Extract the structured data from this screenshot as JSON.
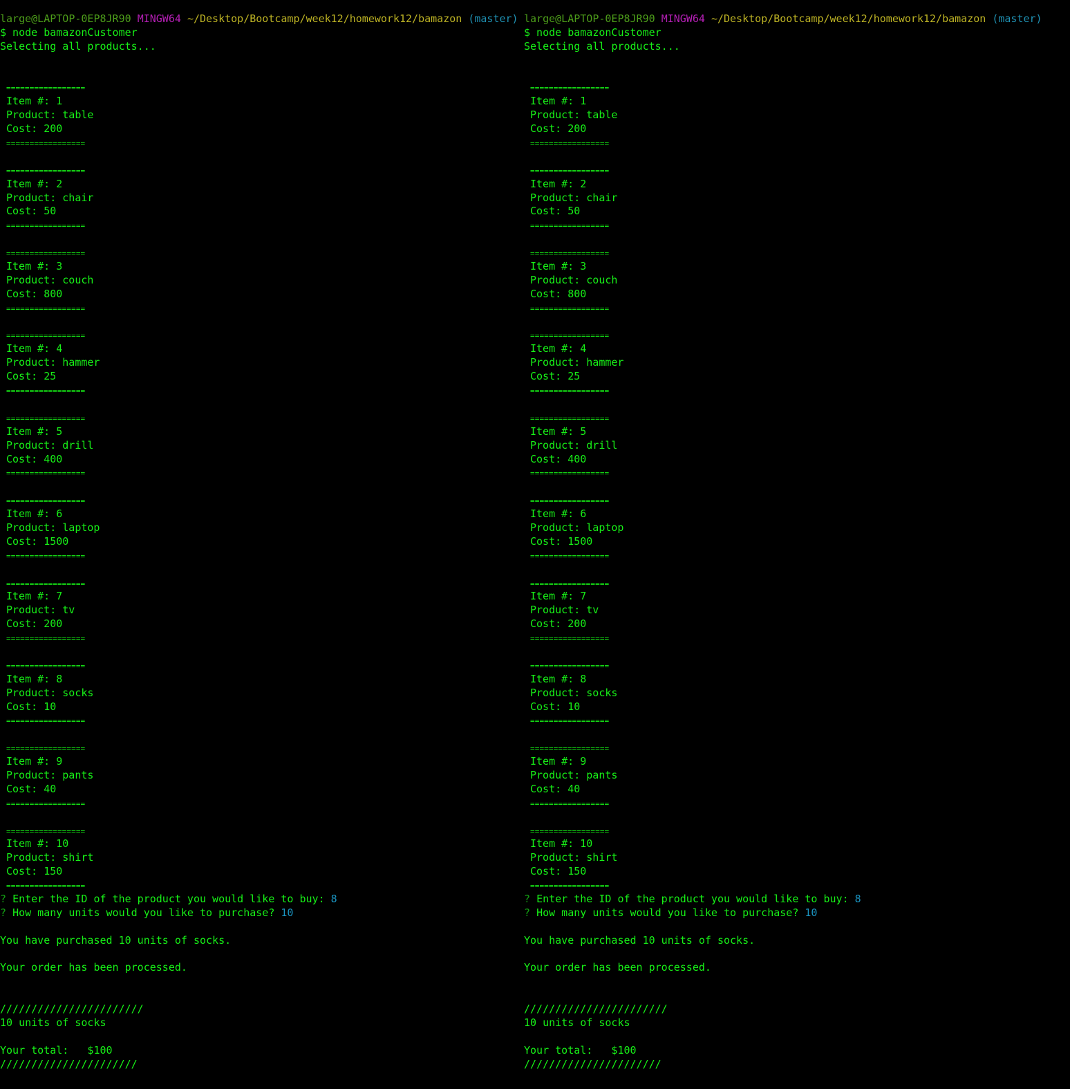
{
  "prompt": {
    "user_host": "large@LAPTOP-0EP8JR90",
    "shell": "MINGW64",
    "path": "~/Desktop/Bootcamp/week12/homework12/bamazon",
    "branch": "(master)",
    "command": "$ node bamazonCustomer"
  },
  "status_line": "Selecting all products...",
  "separator": "=================",
  "item_label": "Item #: ",
  "product_label": "Product: ",
  "cost_label": "Cost: ",
  "products": [
    {
      "id": "1",
      "name": "table",
      "cost": "200"
    },
    {
      "id": "2",
      "name": "chair",
      "cost": "50"
    },
    {
      "id": "3",
      "name": "couch",
      "cost": "800"
    },
    {
      "id": "4",
      "name": "hammer",
      "cost": "25"
    },
    {
      "id": "5",
      "name": "drill",
      "cost": "400"
    },
    {
      "id": "6",
      "name": "laptop",
      "cost": "1500"
    },
    {
      "id": "7",
      "name": "tv",
      "cost": "200"
    },
    {
      "id": "8",
      "name": "socks",
      "cost": "10"
    },
    {
      "id": "9",
      "name": "pants",
      "cost": "40"
    },
    {
      "id": "10",
      "name": "shirt",
      "cost": "150"
    }
  ],
  "questions": [
    {
      "mark": "?",
      "text": "Enter the ID of the product you would like to buy:",
      "answer": "8"
    },
    {
      "mark": "?",
      "text": "How many units would you like to purchase?",
      "answer": "10"
    }
  ],
  "purchase_message": "You have purchased 10 units of socks.",
  "processed_message": "Your order has been processed.",
  "slash_top": "///////////////////////",
  "summary_units": "10 units of socks",
  "total_text": "Your total:   $100",
  "slash_bottom": "//////////////////////",
  "colors": {
    "background": "#000000",
    "output_green": "#17f017",
    "user_host": "#4d9e1a",
    "shell": "#b51fb5",
    "path": "#bdb324",
    "branch": "#1f91b3",
    "answer": "#1a95c2"
  }
}
